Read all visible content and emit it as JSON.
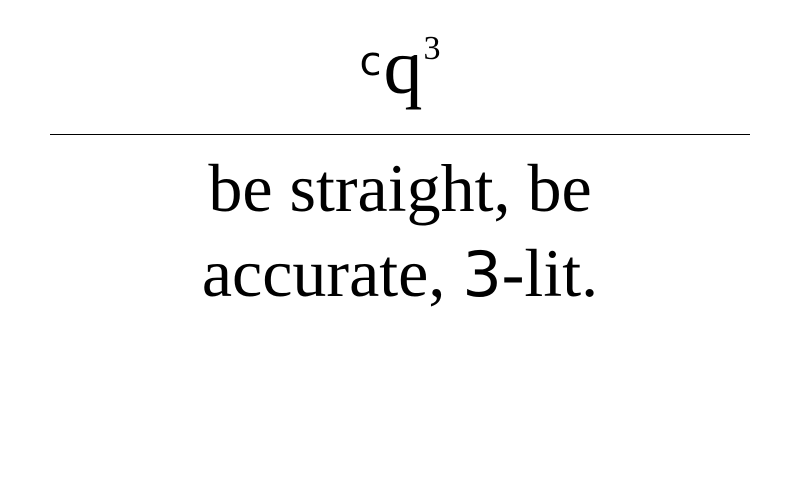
{
  "headword": {
    "prefix": "c",
    "root": "q",
    "suffix": "3"
  },
  "definition": {
    "line1": "be straight, be",
    "line2_part1": "accurate, ",
    "line2_part2": "3",
    "line2_part3": "-lit."
  }
}
